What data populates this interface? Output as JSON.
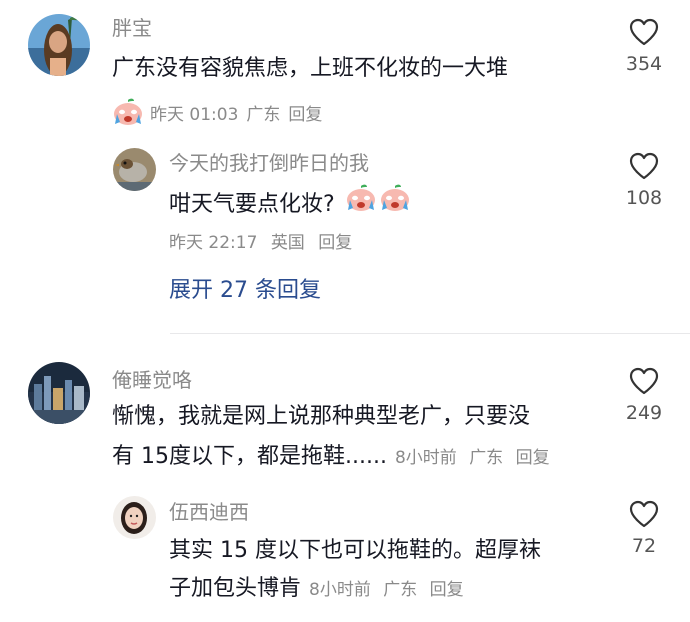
{
  "comments": [
    {
      "username": "胖宝",
      "text": "广东没有容貌焦虑，上班不化妆的一大堆",
      "time": "昨天 01:03",
      "location": "广东",
      "reply_label": "回复",
      "likes": "354",
      "reply": {
        "username": "今天的我打倒昨日的我",
        "text": "咁天气要点化妆?",
        "time": "昨天 22:17",
        "location": "英国",
        "reply_label": "回复",
        "likes": "108"
      },
      "expand_label": "展开 27 条回复"
    },
    {
      "username": "俺睡觉咯",
      "text_line1": "惭愧，我就是网上说那种典型老广，只要没",
      "text_line2": "有 15度以下，都是拖鞋......",
      "time": "8小时前",
      "location": "广东",
      "reply_label": "回复",
      "likes": "249",
      "reply": {
        "username": "伍西迪西",
        "text_line1": "其实 15 度以下也可以拖鞋的。超厚袜",
        "text_line2": "子加包头博肯",
        "time": "8小时前",
        "location": "广东",
        "reply_label": "回复",
        "likes": "72"
      }
    }
  ],
  "icons": {
    "like": "heart-outline-icon",
    "emoji": "crying-face-emoji"
  }
}
